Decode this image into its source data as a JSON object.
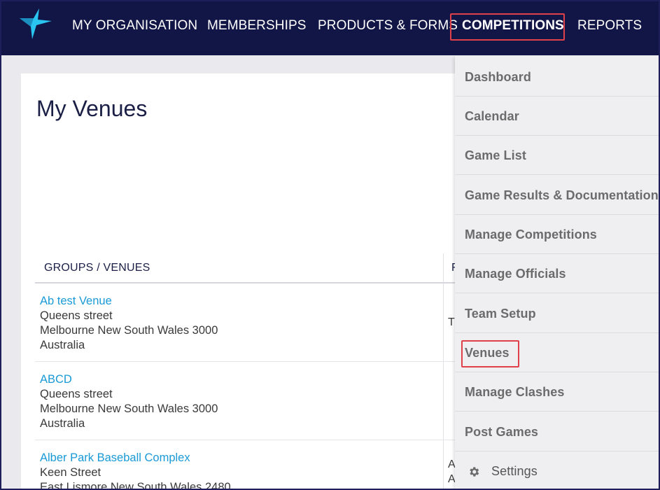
{
  "nav": {
    "items": [
      {
        "label": "MY ORGANISATION"
      },
      {
        "label": "MEMBERSHIPS"
      },
      {
        "label": "PRODUCTS & FORMS"
      },
      {
        "label": "COMPETITIONS"
      },
      {
        "label": "REPORTS"
      }
    ]
  },
  "page": {
    "title": "My Venues",
    "table_header": "GROUPS / VENUES",
    "table_header_2_partial": "F"
  },
  "venues": [
    {
      "name": "Ab test Venue",
      "street": "Queens street",
      "city": "Melbourne New South Wales 3000",
      "country": "Australia",
      "side": "T"
    },
    {
      "name": "ABCD",
      "street": "Queens street",
      "city": "Melbourne New South Wales 3000",
      "country": "Australia",
      "side": ""
    },
    {
      "name": "Alber Park Baseball Complex",
      "street": "Keen Street",
      "city": "East Lismore New South Wales 2480",
      "country": "",
      "side": "A",
      "side2": "A"
    }
  ],
  "dropdown": {
    "items": [
      {
        "label": "Dashboard"
      },
      {
        "label": "Calendar"
      },
      {
        "label": "Game List"
      },
      {
        "label": "Game Results & Documentation"
      },
      {
        "label": "Manage Competitions"
      },
      {
        "label": "Manage Officials"
      },
      {
        "label": "Team Setup"
      },
      {
        "label": "Venues"
      },
      {
        "label": "Manage Clashes"
      },
      {
        "label": "Post Games"
      },
      {
        "label": "Settings",
        "icon": "gear-icon"
      }
    ]
  },
  "colors": {
    "nav_bg": "#121647",
    "highlight": "#e0404a",
    "link": "#1a9ad6",
    "logo": "#29c4f0"
  }
}
